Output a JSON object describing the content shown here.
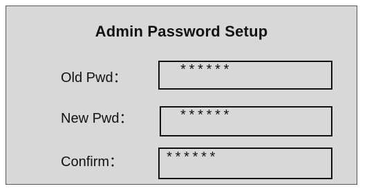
{
  "dialog": {
    "title": "Admin Password Setup",
    "fields": [
      {
        "label": "Old Pwd：",
        "value": "******"
      },
      {
        "label": "New Pwd：",
        "value": "******"
      },
      {
        "label": "Confirm：",
        "value": "******"
      }
    ]
  },
  "colors": {
    "panel_background": "#d8d8d8",
    "panel_border": "#555555",
    "field_border": "#111111",
    "text": "#111111"
  }
}
